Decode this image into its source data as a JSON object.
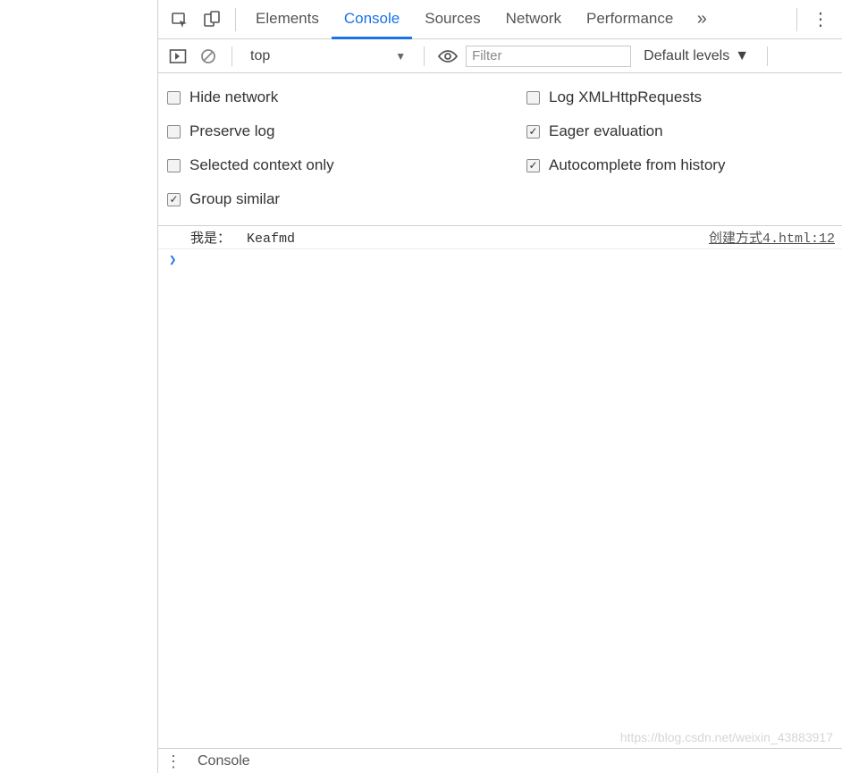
{
  "tabs": {
    "elements": "Elements",
    "console": "Console",
    "sources": "Sources",
    "network": "Network",
    "performance": "Performance"
  },
  "toolbar": {
    "context": "top",
    "filter_placeholder": "Filter",
    "levels": "Default levels"
  },
  "settings": {
    "hide_network": "Hide network",
    "log_xhr": "Log XMLHttpRequests",
    "preserve_log": "Preserve log",
    "eager_eval": "Eager evaluation",
    "selected_context": "Selected context only",
    "autocomplete_history": "Autocomplete from history",
    "group_similar": "Group similar"
  },
  "log": {
    "entries": [
      {
        "message": "我是：  Keafmd",
        "source": "创建方式4.html:12"
      }
    ]
  },
  "drawer": {
    "label": "Console"
  },
  "watermark": "https://blog.csdn.net/weixin_43883917"
}
